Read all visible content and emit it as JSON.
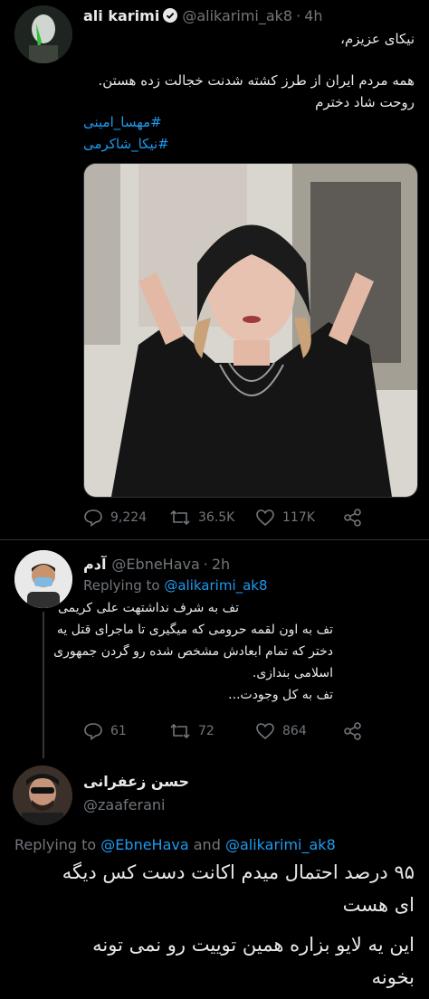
{
  "tweet1": {
    "display_name": "ali karimi",
    "handle": "@alikarimi_ak8",
    "dot": "·",
    "time": "4h",
    "lines": [
      "نیکای عزیزم،",
      "همه مردم ایران از طرز کشته شدنت خجالت زده هستن.",
      "روحت شاد دخترم"
    ],
    "hashtags": [
      "#مهسا_امینی",
      "#نیکا_شاکرمی"
    ],
    "stats": {
      "replies": "9,224",
      "retweets": "36.5K",
      "likes": "117K"
    }
  },
  "tweet2": {
    "display_name": "آدم",
    "handle": "@EbneHava",
    "dot": "·",
    "time": "2h",
    "replying_prefix": "Replying to",
    "replying_to": "@alikarimi_ak8",
    "lines": [
      "تف به شرف نداشتهت علی کریمی",
      "تف به اون لقمه حرومی که میگیری تا ماجرای قتل یه",
      "دختر که تمام ابعادش مشخص شده رو گردن جمهوری",
      "اسلامی بندازی.",
      "تف به کل وجودت..."
    ],
    "stats": {
      "replies": "61",
      "retweets": "72",
      "likes": "864"
    }
  },
  "tweet3": {
    "display_name": "حسن زعفرانی",
    "handle": "@zaaferani",
    "replying_prefix": "Replying to",
    "replying_to_1": "@EbneHava",
    "replying_and": "and",
    "replying_to_2": "@alikarimi_ak8",
    "lines": [
      "۹۵ درصد احتمال میدم اکانت دست کس دیگه",
      "ای هست",
      "این یه لایو بزاره همین توییت رو نمی تونه",
      "بخونه"
    ]
  },
  "colors": {
    "accent": "#1d9bf0",
    "muted": "#71767b",
    "text": "#e7e9ea",
    "background": "#000000"
  }
}
